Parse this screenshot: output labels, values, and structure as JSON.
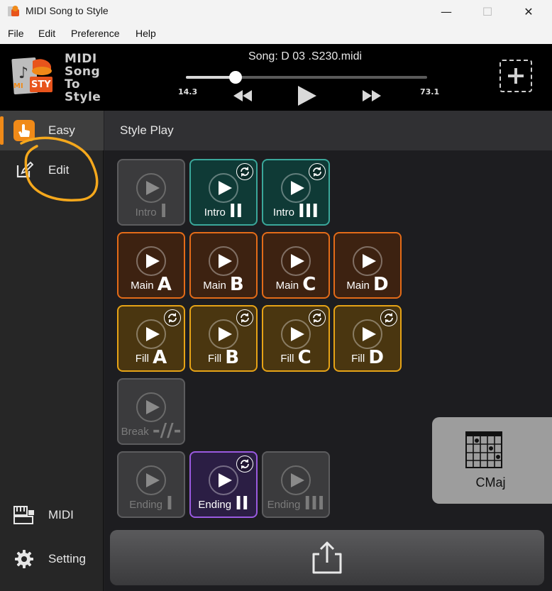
{
  "window": {
    "title": "MIDI Song to Style",
    "minimize_symbol": "—",
    "maximize_symbol": "☐",
    "close_symbol": "✕"
  },
  "menu": {
    "items": [
      "File",
      "Edit",
      "Preference",
      "Help"
    ]
  },
  "player": {
    "logo_lines": [
      "MIDI",
      "Song",
      "To",
      "Style"
    ],
    "logo_badge": "STY",
    "logo_badge_left": "MI",
    "song_label": "Song: D  03 .S230.midi",
    "position_fraction": 0.205,
    "time_start": "14.3",
    "time_end": "73.1"
  },
  "sidebar": {
    "items": [
      {
        "label": "Easy",
        "icon": "hand-pointer-icon",
        "active": true
      },
      {
        "label": "Edit",
        "icon": "edit-icon",
        "active": false
      },
      {
        "label": "MIDI",
        "icon": "midi-keyboard-icon",
        "active": false
      },
      {
        "label": "Setting",
        "icon": "gear-icon",
        "active": false
      }
    ]
  },
  "main": {
    "title": "Style Play",
    "pads": {
      "intro": [
        {
          "word": "Intro",
          "mark": "I",
          "state": "off",
          "loop": false
        },
        {
          "word": "Intro",
          "mark": "II",
          "state": "on",
          "loop": true
        },
        {
          "word": "Intro",
          "mark": "III",
          "state": "on",
          "loop": true
        }
      ],
      "main": [
        {
          "word": "Main",
          "mark": "A",
          "state": "on",
          "loop": false
        },
        {
          "word": "Main",
          "mark": "B",
          "state": "on",
          "loop": false
        },
        {
          "word": "Main",
          "mark": "C",
          "state": "on",
          "loop": false
        },
        {
          "word": "Main",
          "mark": "D",
          "state": "on",
          "loop": false
        }
      ],
      "fill": [
        {
          "word": "Fill",
          "mark": "A",
          "state": "on",
          "loop": true
        },
        {
          "word": "Fill",
          "mark": "B",
          "state": "on",
          "loop": true
        },
        {
          "word": "Fill",
          "mark": "C",
          "state": "on",
          "loop": true
        },
        {
          "word": "Fill",
          "mark": "D",
          "state": "on",
          "loop": true
        }
      ],
      "break": [
        {
          "word": "Break",
          "mark": "-//-",
          "state": "off",
          "loop": false
        }
      ],
      "ending": [
        {
          "word": "Ending",
          "mark": "I",
          "state": "off",
          "loop": false
        },
        {
          "word": "Ending",
          "mark": "II",
          "state": "on",
          "loop": true
        },
        {
          "word": "Ending",
          "mark": "III",
          "state": "off",
          "loop": false
        }
      ]
    },
    "chord": "CMaj"
  },
  "colors": {
    "accent_orange": "#f08a18",
    "intro": "#3aa79a",
    "main": "#e36b18",
    "fill": "#e6a316",
    "ending": "#9a5ae0",
    "annotation": "#f5a81c"
  }
}
